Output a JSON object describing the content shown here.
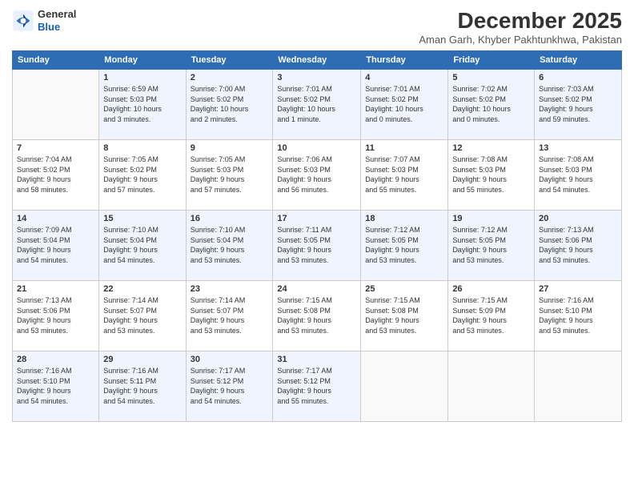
{
  "logo": {
    "general": "General",
    "blue": "Blue"
  },
  "header": {
    "month_title": "December 2025",
    "subtitle": "Aman Garh, Khyber Pakhtunkhwa, Pakistan"
  },
  "weekdays": [
    "Sunday",
    "Monday",
    "Tuesday",
    "Wednesday",
    "Thursday",
    "Friday",
    "Saturday"
  ],
  "weeks": [
    [
      {
        "day": "",
        "info": ""
      },
      {
        "day": "1",
        "info": "Sunrise: 6:59 AM\nSunset: 5:03 PM\nDaylight: 10 hours\nand 3 minutes."
      },
      {
        "day": "2",
        "info": "Sunrise: 7:00 AM\nSunset: 5:02 PM\nDaylight: 10 hours\nand 2 minutes."
      },
      {
        "day": "3",
        "info": "Sunrise: 7:01 AM\nSunset: 5:02 PM\nDaylight: 10 hours\nand 1 minute."
      },
      {
        "day": "4",
        "info": "Sunrise: 7:01 AM\nSunset: 5:02 PM\nDaylight: 10 hours\nand 0 minutes."
      },
      {
        "day": "5",
        "info": "Sunrise: 7:02 AM\nSunset: 5:02 PM\nDaylight: 10 hours\nand 0 minutes."
      },
      {
        "day": "6",
        "info": "Sunrise: 7:03 AM\nSunset: 5:02 PM\nDaylight: 9 hours\nand 59 minutes."
      }
    ],
    [
      {
        "day": "7",
        "info": "Sunrise: 7:04 AM\nSunset: 5:02 PM\nDaylight: 9 hours\nand 58 minutes."
      },
      {
        "day": "8",
        "info": "Sunrise: 7:05 AM\nSunset: 5:02 PM\nDaylight: 9 hours\nand 57 minutes."
      },
      {
        "day": "9",
        "info": "Sunrise: 7:05 AM\nSunset: 5:03 PM\nDaylight: 9 hours\nand 57 minutes."
      },
      {
        "day": "10",
        "info": "Sunrise: 7:06 AM\nSunset: 5:03 PM\nDaylight: 9 hours\nand 56 minutes."
      },
      {
        "day": "11",
        "info": "Sunrise: 7:07 AM\nSunset: 5:03 PM\nDaylight: 9 hours\nand 55 minutes."
      },
      {
        "day": "12",
        "info": "Sunrise: 7:08 AM\nSunset: 5:03 PM\nDaylight: 9 hours\nand 55 minutes."
      },
      {
        "day": "13",
        "info": "Sunrise: 7:08 AM\nSunset: 5:03 PM\nDaylight: 9 hours\nand 54 minutes."
      }
    ],
    [
      {
        "day": "14",
        "info": "Sunrise: 7:09 AM\nSunset: 5:04 PM\nDaylight: 9 hours\nand 54 minutes."
      },
      {
        "day": "15",
        "info": "Sunrise: 7:10 AM\nSunset: 5:04 PM\nDaylight: 9 hours\nand 54 minutes."
      },
      {
        "day": "16",
        "info": "Sunrise: 7:10 AM\nSunset: 5:04 PM\nDaylight: 9 hours\nand 53 minutes."
      },
      {
        "day": "17",
        "info": "Sunrise: 7:11 AM\nSunset: 5:05 PM\nDaylight: 9 hours\nand 53 minutes."
      },
      {
        "day": "18",
        "info": "Sunrise: 7:12 AM\nSunset: 5:05 PM\nDaylight: 9 hours\nand 53 minutes."
      },
      {
        "day": "19",
        "info": "Sunrise: 7:12 AM\nSunset: 5:05 PM\nDaylight: 9 hours\nand 53 minutes."
      },
      {
        "day": "20",
        "info": "Sunrise: 7:13 AM\nSunset: 5:06 PM\nDaylight: 9 hours\nand 53 minutes."
      }
    ],
    [
      {
        "day": "21",
        "info": "Sunrise: 7:13 AM\nSunset: 5:06 PM\nDaylight: 9 hours\nand 53 minutes."
      },
      {
        "day": "22",
        "info": "Sunrise: 7:14 AM\nSunset: 5:07 PM\nDaylight: 9 hours\nand 53 minutes."
      },
      {
        "day": "23",
        "info": "Sunrise: 7:14 AM\nSunset: 5:07 PM\nDaylight: 9 hours\nand 53 minutes."
      },
      {
        "day": "24",
        "info": "Sunrise: 7:15 AM\nSunset: 5:08 PM\nDaylight: 9 hours\nand 53 minutes."
      },
      {
        "day": "25",
        "info": "Sunrise: 7:15 AM\nSunset: 5:08 PM\nDaylight: 9 hours\nand 53 minutes."
      },
      {
        "day": "26",
        "info": "Sunrise: 7:15 AM\nSunset: 5:09 PM\nDaylight: 9 hours\nand 53 minutes."
      },
      {
        "day": "27",
        "info": "Sunrise: 7:16 AM\nSunset: 5:10 PM\nDaylight: 9 hours\nand 53 minutes."
      }
    ],
    [
      {
        "day": "28",
        "info": "Sunrise: 7:16 AM\nSunset: 5:10 PM\nDaylight: 9 hours\nand 54 minutes."
      },
      {
        "day": "29",
        "info": "Sunrise: 7:16 AM\nSunset: 5:11 PM\nDaylight: 9 hours\nand 54 minutes."
      },
      {
        "day": "30",
        "info": "Sunrise: 7:17 AM\nSunset: 5:12 PM\nDaylight: 9 hours\nand 54 minutes."
      },
      {
        "day": "31",
        "info": "Sunrise: 7:17 AM\nSunset: 5:12 PM\nDaylight: 9 hours\nand 55 minutes."
      },
      {
        "day": "",
        "info": ""
      },
      {
        "day": "",
        "info": ""
      },
      {
        "day": "",
        "info": ""
      }
    ]
  ]
}
